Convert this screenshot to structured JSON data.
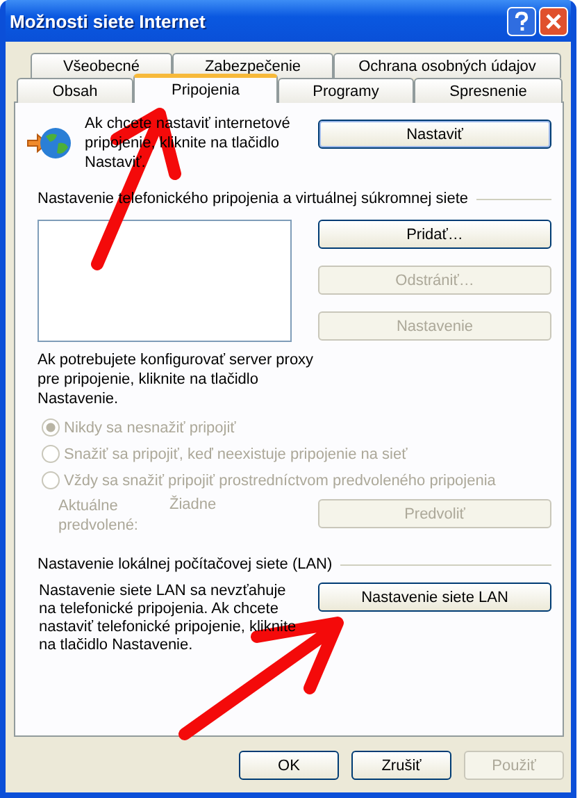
{
  "window": {
    "title": "Možnosti siete Internet"
  },
  "tab_rows": [
    {
      "tabs": [
        {
          "label": "Všeobecné",
          "selected": false
        },
        {
          "label": "Zabezpečenie",
          "selected": false
        },
        {
          "label": "Ochrana osobných údajov",
          "selected": false
        }
      ]
    },
    {
      "tabs": [
        {
          "label": "Obsah",
          "selected": false
        },
        {
          "label": "Pripojenia",
          "selected": true
        },
        {
          "label": "Programy",
          "selected": false
        },
        {
          "label": "Spresnenie",
          "selected": false
        }
      ]
    }
  ],
  "setup": {
    "text": "Ak chcete nastaviť internetové pripojenie, kliknite na tlačidlo Nastaviť.",
    "button": {
      "label": "Nastaviť",
      "disabled": false
    }
  },
  "dialup": {
    "heading": "Nastavenie telefonického pripojenia a virtuálnej súkromnej siete",
    "buttons": [
      {
        "label": "Pridať…",
        "disabled": false
      },
      {
        "label": "Odstrániť…",
        "disabled": true
      },
      {
        "label": "Nastavenie",
        "disabled": true
      }
    ],
    "proxy_text": "Ak potrebujete konfigurovať server proxy pre pripojenie, kliknite na tlačidlo Nastavenie.",
    "radios": [
      {
        "label": "Nikdy sa nesnažiť pripojiť",
        "selected": true,
        "disabled": true
      },
      {
        "label": "Snažiť sa pripojiť, keď neexistuje pripojenie na sieť",
        "selected": false,
        "disabled": true
      },
      {
        "label": "Vždy sa snažiť pripojiť prostredníctvom predvoleného pripojenia",
        "selected": false,
        "disabled": true
      }
    ],
    "default_label": "Aktuálne predvolené:",
    "default_value": "Žiadne",
    "default_disabled": true,
    "default_button": {
      "label": "Predvoliť",
      "disabled": true
    }
  },
  "lan": {
    "heading": "Nastavenie lokálnej počítačovej siete (LAN)",
    "text": "Nastavenie siete LAN sa nevzťahuje na telefonické pripojenia. Ak chcete nastaviť telefonické pripojenie, kliknite na tlačidlo Nastavenie.",
    "button": {
      "label": "Nastavenie siete LAN",
      "disabled": false
    }
  },
  "footer": [
    {
      "label": "OK",
      "disabled": false
    },
    {
      "label": "Zrušiť",
      "disabled": false
    },
    {
      "label": "Použiť",
      "disabled": true
    }
  ]
}
